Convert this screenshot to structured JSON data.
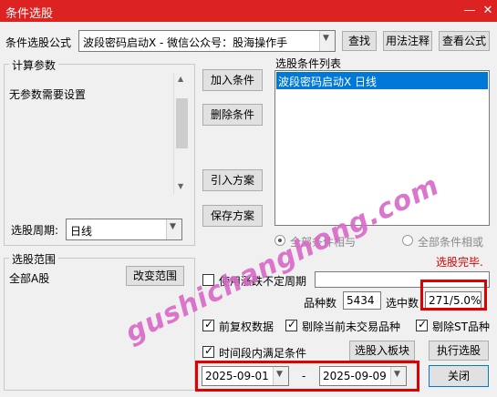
{
  "window": {
    "title": "条件选股"
  },
  "formula": {
    "label": "条件选股公式",
    "value": "波段密码启动X  -  微信公众号：股海操作手"
  },
  "buttons": {
    "find": "查找",
    "usage": "用法注释",
    "view_formula": "查看公式",
    "add_condition": "加入条件",
    "delete_condition": "删除条件",
    "import_plan": "引入方案",
    "save_plan": "保存方案",
    "change_range": "改变范围",
    "select_into_block": "选股入板块",
    "execute": "执行选股",
    "close": "关闭"
  },
  "params": {
    "legend": "计算参数",
    "text": "无参数需要设置"
  },
  "period": {
    "label": "选股周期:",
    "value": "日线"
  },
  "condition_list": {
    "label": "选股条件列表",
    "items": [
      "波段密码启动X  日线"
    ]
  },
  "logic": {
    "and_label": "全部条件相与",
    "or_label": "全部条件相或"
  },
  "status": "选股完毕.",
  "range": {
    "legend": "选股范围",
    "value": "全部A股"
  },
  "variable_period": {
    "label": "使用涨跌不定周期"
  },
  "stats": {
    "count_label": "品种数",
    "count": "5434",
    "selected_label": "选中数",
    "selected": "271/5.0%"
  },
  "options": {
    "forward_adjust": "前复权数据",
    "exclude_untraded": "剔除当前未交易品种",
    "exclude_st": "剔除ST品种",
    "time_range": "时间段内满足条件"
  },
  "dates": {
    "start": "2025-09-01",
    "separator": "-",
    "end": "2025-09-09"
  },
  "watermark": "gushichanghong.com",
  "colors": {
    "titlebar": "#dd2222",
    "selected": "#0078d7",
    "highlight": "#e00000"
  }
}
